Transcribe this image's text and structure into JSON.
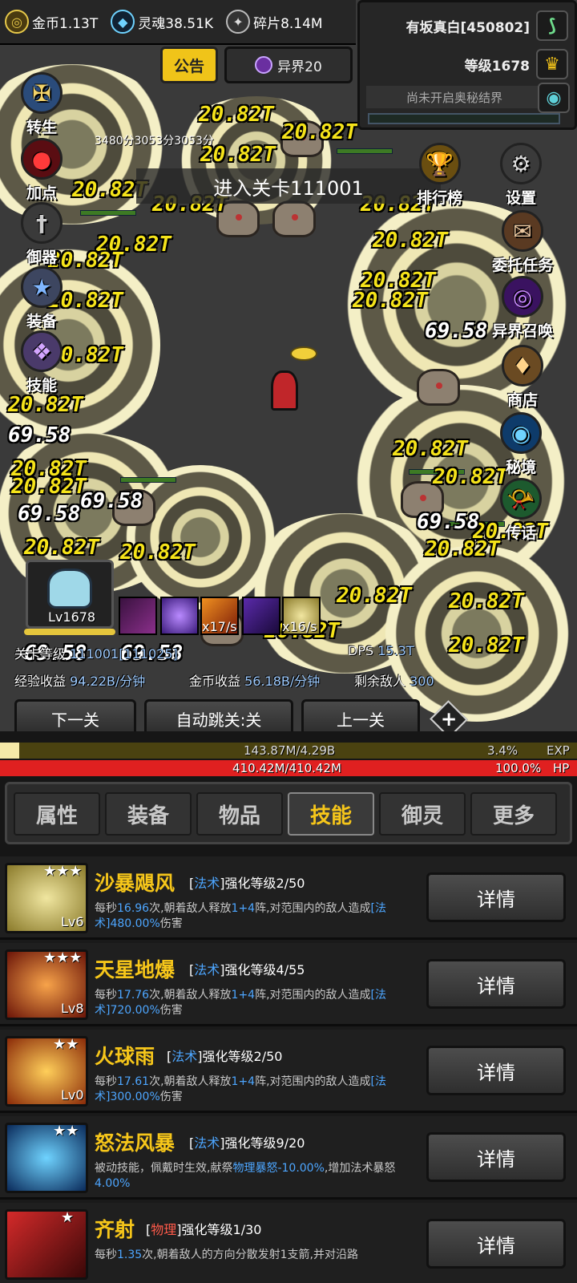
{
  "currencies": [
    {
      "label": "金币1.13T",
      "icon": "coin-icon",
      "color": "#e7c94a"
    },
    {
      "label": "灵魂38.51K",
      "icon": "soul-icon",
      "color": "#6fd3ff"
    },
    {
      "label": "碎片8.14M",
      "icon": "shard-icon",
      "color": "#bbbbbb"
    }
  ],
  "tabs_top": {
    "notice": "公告",
    "other_world": "异界20"
  },
  "player": {
    "name": "有坂真白[450802]",
    "level": "等级1678",
    "portal": "尚未开启奥秘结界"
  },
  "left_menu": [
    "转生",
    "加点",
    "御器",
    "装备",
    "技能"
  ],
  "right_menu": [
    "排行榜",
    "设置",
    "委托任务",
    "异界召唤",
    "商店",
    "秘境",
    "传话"
  ],
  "battle": {
    "stage_banner": "进入关卡111001",
    "score_text": "3480分3053分3053分",
    "damage_yellow": "20.82T",
    "damage_white": "69.58",
    "hero_level": "Lv1678",
    "skill_rates": [
      "x17/s",
      "x16/s"
    ]
  },
  "stats": {
    "stage_label": "关卡等级",
    "stage_value": "111001[111025]",
    "dps_label": "DPS",
    "dps_value": "15.3T",
    "exp_label": "经验收益",
    "exp_value": "94.22B/分钟",
    "gold_label": "金币收益",
    "gold_value": "56.18B/分钟",
    "enemies_label": "剩余敌人",
    "enemies_value": "300"
  },
  "nav": {
    "prev": "下一关",
    "auto": "自动跳关:关",
    "next": "上一关",
    "plus": "+"
  },
  "exp_bar": {
    "text": "143.87M/4.29B",
    "pct_text": "3.4%",
    "label": "EXP",
    "fraction": 0.034
  },
  "hp_bar": {
    "text": "410.42M/410.42M",
    "pct_text": "100.0%",
    "label": "HP",
    "fraction": 1.0
  },
  "tabs": [
    "属性",
    "装备",
    "物品",
    "技能",
    "御灵",
    "更多"
  ],
  "active_tab": 3,
  "detail_label": "详情",
  "skills": [
    {
      "name": "沙暴飓风",
      "type": "法术",
      "type_color": "blue",
      "level_text": "强化等级2/50",
      "lv": "Lv6",
      "stars": "★★★",
      "d1": "每秒",
      "v1": "16.96",
      "d2": "次,朝着敌人释放",
      "v2": "1+4",
      "d3": "阵,对范围内的敌人造成",
      "v3": "[法术]",
      "d4": "480.00%",
      "d5": "伤害",
      "icon_color": "#c9b64a"
    },
    {
      "name": "天星地爆",
      "type": "法术",
      "type_color": "blue",
      "level_text": "强化等级4/55",
      "lv": "Lv8",
      "stars": "★★★",
      "d1": "每秒",
      "v1": "17.76",
      "d2": "次,朝着敌人释放",
      "v2": "1+4",
      "d3": "阵,对范围内的敌人造成",
      "v3": "[法术]",
      "d4": "720.00%",
      "d5": "伤害",
      "icon_color": "#d0561e"
    },
    {
      "name": "火球雨",
      "type": "法术",
      "type_color": "blue",
      "level_text": "强化等级2/50",
      "lv": "Lv0",
      "stars": "★★",
      "d1": "每秒",
      "v1": "17.61",
      "d2": "次,朝着敌人释放",
      "v2": "1+4",
      "d3": "阵,对范围内的敌人造成",
      "v3": "[法术]",
      "d4": "300.00%",
      "d5": "伤害",
      "icon_color": "#e07a12"
    },
    {
      "name": "怒法风暴",
      "type": "法术",
      "type_color": "blue",
      "level_text": "强化等级9/20",
      "lv": "",
      "stars": "★★",
      "passive1": "被动技能，佩戴时生效,献祭",
      "passive2": "物理暴怒-10.00%",
      "passive3": ",增加法术暴怒",
      "passive4": "4.00%",
      "icon_color": "#1f6fb5"
    },
    {
      "name": "齐射",
      "type": "物理",
      "type_color": "red",
      "level_text": "强化等级1/30",
      "lv": "",
      "stars": "★",
      "d1": "每秒",
      "v1": "1.35",
      "d2": "次,朝着敌人的方向分散发射1支箭,并对沿路",
      "icon_color": "#b4242a"
    }
  ]
}
